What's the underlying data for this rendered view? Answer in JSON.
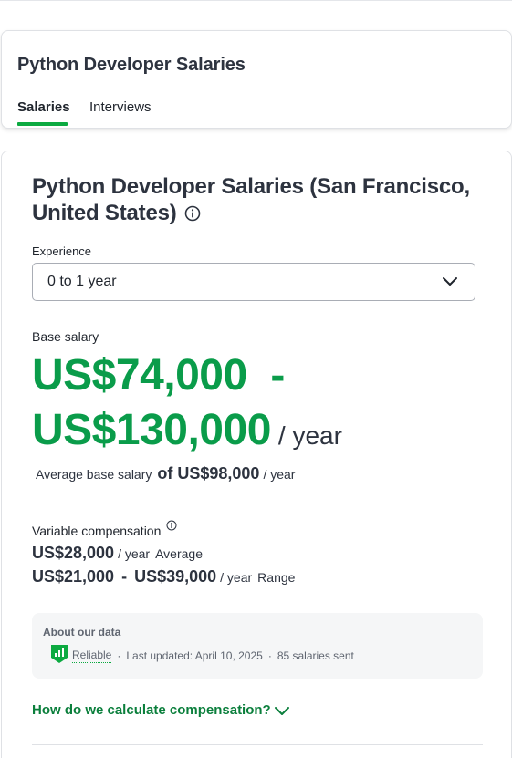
{
  "header": {
    "title": "Python Developer Salaries",
    "tabs": [
      {
        "label": "Salaries",
        "active": true
      },
      {
        "label": "Interviews",
        "active": false
      }
    ]
  },
  "main": {
    "title": "Python Developer Salaries (San Francisco, United States)",
    "experience": {
      "label": "Experience",
      "selected": "0 to 1 year"
    },
    "base_salary": {
      "label": "Base salary",
      "range_low": "US$74,000",
      "dash": "-",
      "range_high": "US$130,000",
      "per": "/ year",
      "avg_label": "Average base salary",
      "avg_value": "of US$98,000",
      "avg_per": "/ year"
    },
    "variable": {
      "label": "Variable compensation",
      "average_value": "US$28,000",
      "average_per": "/ year",
      "average_tag": "Average",
      "range_low": "US$21,000",
      "dash": "-",
      "range_high": "US$39,000",
      "range_per": "/ year",
      "range_tag": "Range"
    },
    "about": {
      "title": "About our data",
      "reliability": "Reliable",
      "dot1": "·",
      "updated": "Last updated: April 10, 2025",
      "dot2": "·",
      "count": "85 salaries sent"
    },
    "calc_link": "How do we calculate compensation?"
  },
  "colors": {
    "accent_green": "#0a9c4a",
    "link_green": "#0b7f3c",
    "tab_underline": "#0caa41",
    "text": "#2d333f"
  },
  "icons": [
    "info-icon",
    "chevron-down-icon",
    "reliable-badge-icon"
  ]
}
